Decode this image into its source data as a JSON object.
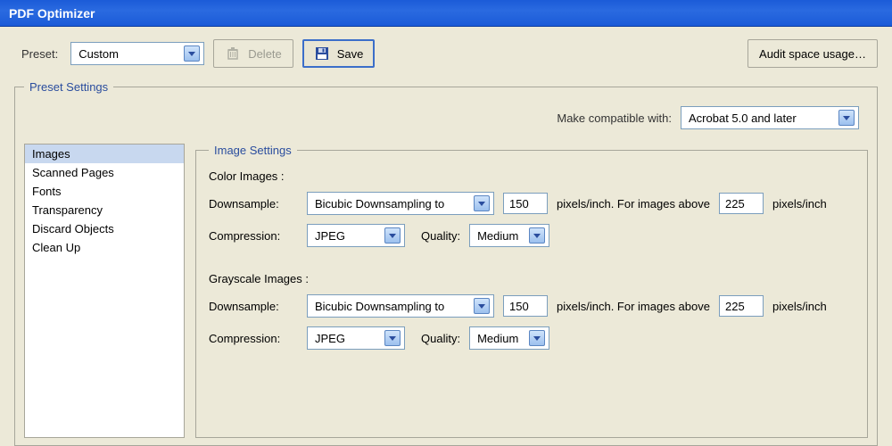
{
  "window": {
    "title": "PDF Optimizer"
  },
  "toolbar": {
    "preset_label": "Preset:",
    "preset_value": "Custom",
    "delete_label": "Delete",
    "save_label": "Save",
    "audit_label": "Audit space usage…"
  },
  "preset_settings_legend": "Preset Settings",
  "compat": {
    "label": "Make compatible with:",
    "value": "Acrobat 5.0 and later"
  },
  "categories": [
    "Images",
    "Scanned Pages",
    "Fonts",
    "Transparency",
    "Discard Objects",
    "Clean Up"
  ],
  "image_settings": {
    "legend": "Image Settings",
    "color_heading": "Color Images :",
    "gray_heading": "Grayscale Images :",
    "downsample_label": "Downsample:",
    "compression_label": "Compression:",
    "quality_label": "Quality:",
    "units1": "pixels/inch. For images above",
    "units2": "pixels/inch",
    "color": {
      "method": "Bicubic Downsampling to",
      "ppi": "150",
      "above": "225",
      "compression": "JPEG",
      "quality": "Medium"
    },
    "gray": {
      "method": "Bicubic Downsampling to",
      "ppi": "150",
      "above": "225",
      "compression": "JPEG",
      "quality": "Medium"
    }
  }
}
